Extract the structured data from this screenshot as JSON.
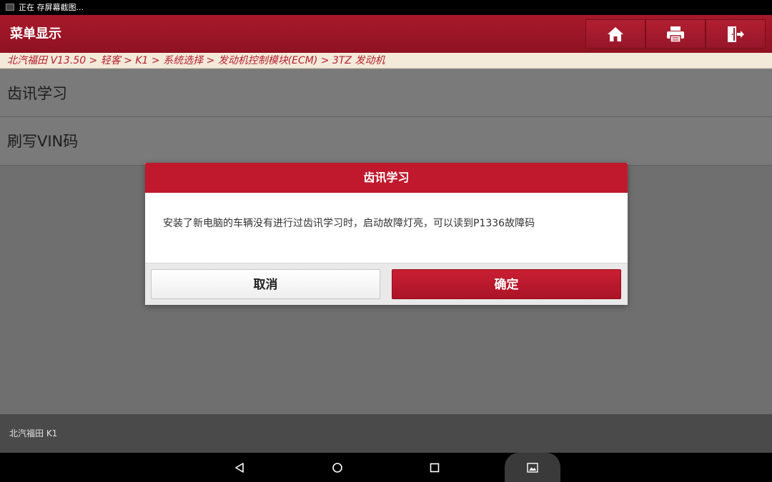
{
  "status_bar": {
    "text": "正在 存屏幕截图..."
  },
  "header": {
    "title": "菜单显示"
  },
  "breadcrumb": {
    "text": "北汽福田 V13.50 > 轻客 > K1 > 系统选择 > 发动机控制模块(ECM) > 3TZ 发动机"
  },
  "menu": {
    "items": [
      {
        "label": "齿讯学习"
      },
      {
        "label": "刷写VIN码"
      }
    ]
  },
  "dialog": {
    "title": "齿讯学习",
    "message": "安装了新电脑的车辆没有进行过齿讯学习时，启动故障灯亮，可以读到P1336故障码",
    "cancel_label": "取消",
    "ok_label": "确定"
  },
  "footer": {
    "text": "北汽福田 K1"
  },
  "icons": {
    "home": "home-icon",
    "print": "print-icon",
    "exit": "exit-icon",
    "back": "back-icon",
    "nav_home": "circle-home-icon",
    "recents": "recents-icon",
    "screenshot": "screenshot-icon"
  },
  "colors": {
    "accent": "#c0192d",
    "header": "#a8192b",
    "breadcrumb_text": "#b61d2e"
  }
}
